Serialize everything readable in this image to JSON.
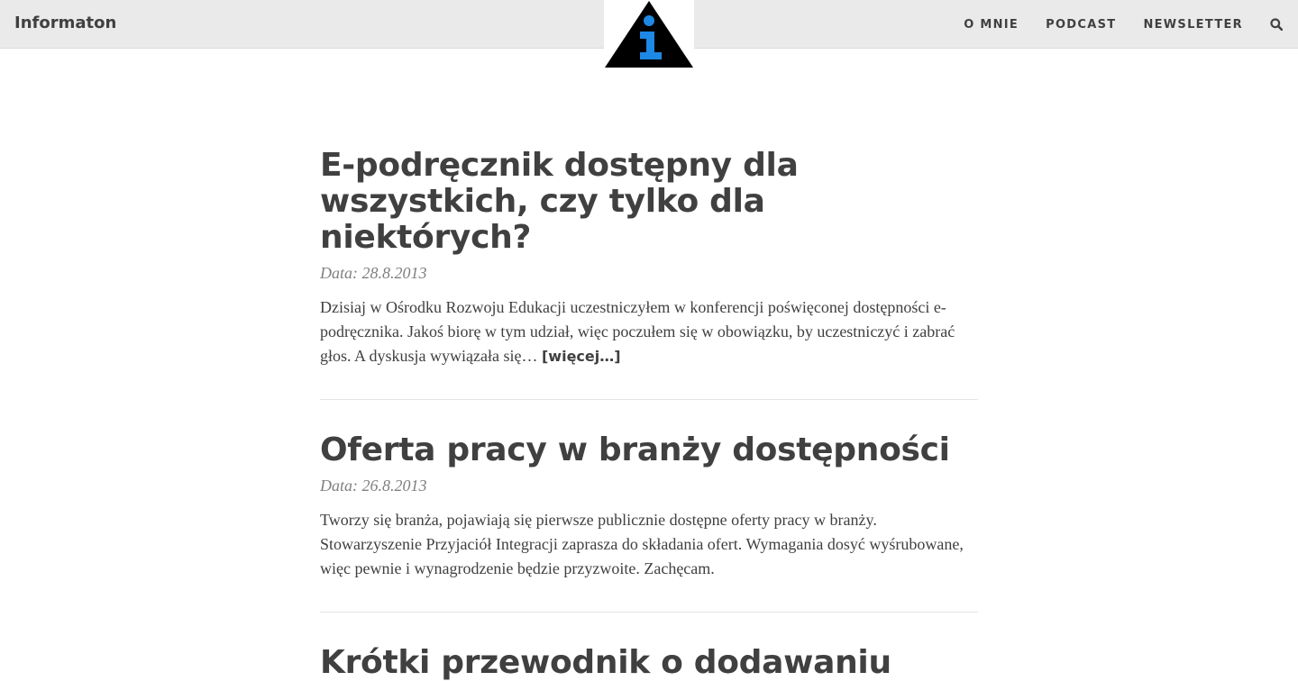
{
  "header": {
    "brand": "Informaton",
    "logo_icon": "info-triangle-icon",
    "nav": [
      {
        "label": "O MNIE"
      },
      {
        "label": "PODCAST"
      },
      {
        "label": "NEWSLETTER"
      }
    ],
    "search_icon": "search-icon",
    "colors": {
      "bar": "#eaeaea",
      "logo_triangle": "#000000",
      "logo_i": "#1e88e5"
    }
  },
  "posts": [
    {
      "title": "E-podręcznik dostępny dla wszystkich, czy tylko dla niektórych?",
      "date": "Data: 28.8.2013",
      "excerpt": "Dzisiaj w Ośrodku Rozwoju Edukacji uczestniczyłem w konferencji poświęconej dostępności e-podręcznika. Jakoś biorę w tym udział, więc poczułem się w obowiązku, by uczestniczyć i zabrać głos. A dyskusja wywiązała się… ",
      "more": "[więcej…]"
    },
    {
      "title": "Oferta pracy w branży dostępności",
      "date": "Data: 26.8.2013",
      "excerpt": "Tworzy się branża, pojawiają się pierwsze publicznie dostępne oferty pracy w branży. Stowarzyszenie Przyjaciół Integracji zaprasza do składania ofert. Wymagania dosyć wyśrubowane, więc pewnie i wynagrodzenie będzie przyzwoite. Zachęcam."
    },
    {
      "title": "Krótki przewodnik o dodawaniu"
    }
  ]
}
